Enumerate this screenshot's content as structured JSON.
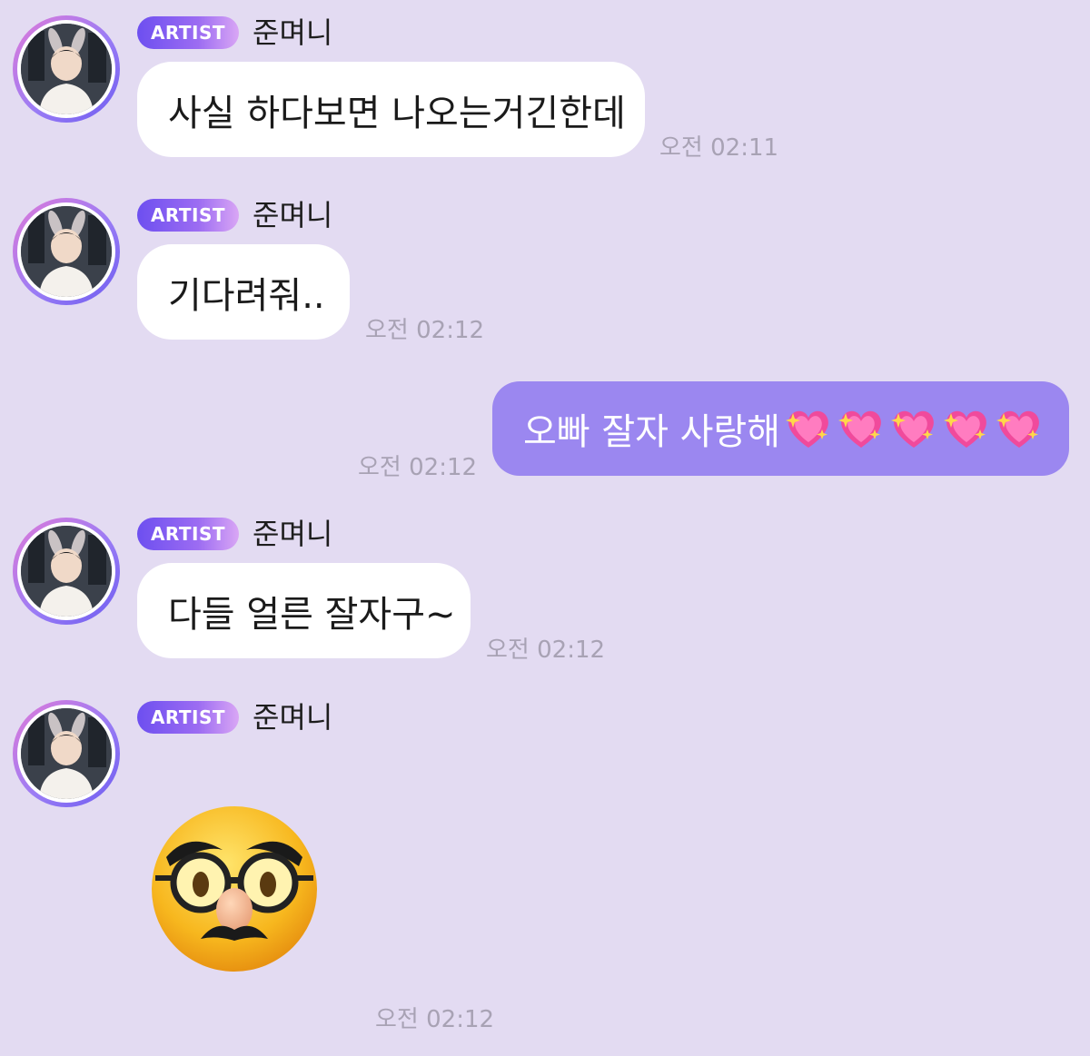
{
  "messages": [
    {
      "sender": "준며니",
      "badge": "ARTIST",
      "text": "사실 하다보면 나오는거긴한데",
      "time": "오전 02:11"
    },
    {
      "sender": "준며니",
      "badge": "ARTIST",
      "text": "기다려줘..",
      "time": "오전 02:12"
    },
    {
      "sender": "me",
      "text": "오빠 잘자 사랑해",
      "emoji": [
        "sparkling-heart",
        "sparkling-heart",
        "sparkling-heart",
        "sparkling-heart",
        "sparkling-heart"
      ],
      "time": "오전 02:12"
    },
    {
      "sender": "준며니",
      "badge": "ARTIST",
      "text": "다들 얼른 잘자구~",
      "time": "오전 02:12"
    },
    {
      "sender": "준며니",
      "badge": "ARTIST",
      "emoji": "disguised-face",
      "time": "오전 02:12"
    }
  ],
  "colors": {
    "background": "#e3dbf2",
    "my_bubble": "#9b87f0",
    "other_bubble": "#ffffff",
    "badge_start": "#6d4ff0",
    "badge_end": "#d9a6f5"
  }
}
